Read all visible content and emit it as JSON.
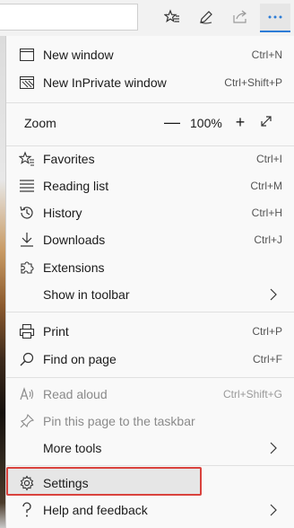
{
  "toolbar": {
    "icons": [
      "favorites-star-icon",
      "pen-icon",
      "share-icon",
      "more-icon"
    ]
  },
  "menu": {
    "new_window": {
      "label": "New window",
      "shortcut": "Ctrl+N"
    },
    "new_inprivate": {
      "label": "New InPrivate window",
      "shortcut": "Ctrl+Shift+P"
    },
    "zoom": {
      "label": "Zoom",
      "minus": "—",
      "value": "100%",
      "plus": "+"
    },
    "favorites": {
      "label": "Favorites",
      "shortcut": "Ctrl+I"
    },
    "reading_list": {
      "label": "Reading list",
      "shortcut": "Ctrl+M"
    },
    "history": {
      "label": "History",
      "shortcut": "Ctrl+H"
    },
    "downloads": {
      "label": "Downloads",
      "shortcut": "Ctrl+J"
    },
    "extensions": {
      "label": "Extensions"
    },
    "show_in_toolbar": {
      "label": "Show in toolbar"
    },
    "print": {
      "label": "Print",
      "shortcut": "Ctrl+P"
    },
    "find_on_page": {
      "label": "Find on page",
      "shortcut": "Ctrl+F"
    },
    "read_aloud": {
      "label": "Read aloud",
      "shortcut": "Ctrl+Shift+G"
    },
    "pin_taskbar": {
      "label": "Pin this page to the taskbar"
    },
    "more_tools": {
      "label": "More tools"
    },
    "settings": {
      "label": "Settings"
    },
    "help": {
      "label": "Help and feedback"
    }
  },
  "colors": {
    "accent": "#2d7cd6",
    "highlight_border": "#d9423d"
  }
}
